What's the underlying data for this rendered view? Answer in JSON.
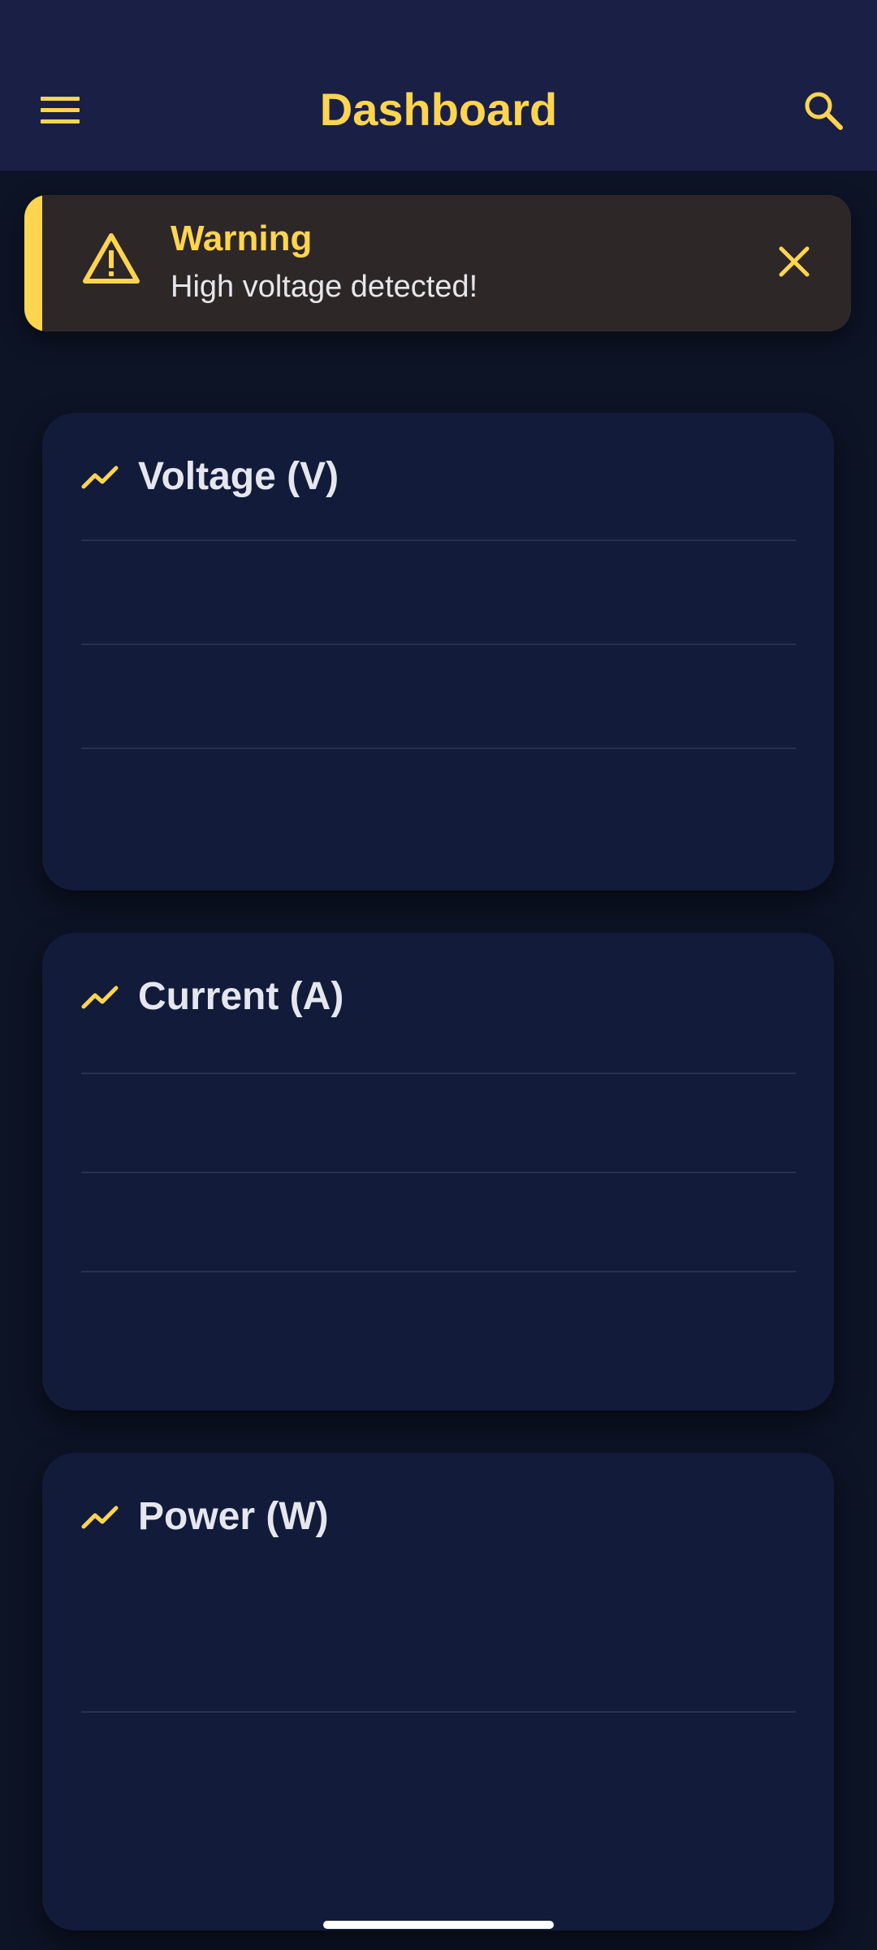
{
  "app_bar": {
    "title": "Dashboard",
    "menu_icon": "hamburger-menu-icon",
    "search_icon": "search-icon"
  },
  "alert": {
    "title": "Warning",
    "message": "High voltage detected!",
    "icon": "warning-triangle-icon",
    "close_icon": "close-icon"
  },
  "cards": [
    {
      "title": "Voltage (V)",
      "icon": "trending-up-icon"
    },
    {
      "title": "Current (A)",
      "icon": "trending-up-icon"
    },
    {
      "title": "Power (W)",
      "icon": "trending-up-icon"
    }
  ],
  "colors": {
    "accent": "#ffd54f",
    "app_bar_bg": "#1a2045",
    "page_bg": "#0d1426",
    "card_bg": "#121b3a",
    "alert_bg": "#2e2728"
  }
}
